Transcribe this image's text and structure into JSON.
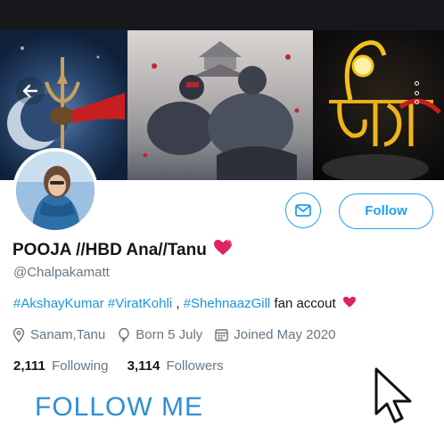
{
  "profile": {
    "display_name": "POOJA //HBD Ana//Tanu",
    "handle": "@Chalpakamatt",
    "bio": {
      "tags": [
        "#AkshayKumar",
        "#ViratKohli",
        "#ShehnaazGill"
      ],
      "separator": ",",
      "text": "fan accout"
    },
    "location": "Sanam,Tanu",
    "born": "Born 5 July",
    "joined": "Joined May 2020",
    "following_count": "2,111",
    "following_label": "Following",
    "followers_count": "3,114",
    "followers_label": "Followers"
  },
  "actions": {
    "follow_label": "Follow",
    "message_icon": "envelope-icon",
    "back_icon": "arrow-left-icon",
    "more_icon": "vertical-dots-icon"
  },
  "overlay": {
    "caption": "FOLLOW ME",
    "cursor_icon": "mouse-pointer-icon"
  },
  "colors": {
    "accent": "#1da1f2",
    "link": "#1b95e0",
    "secondary_text": "#657786",
    "caption": "#2e8fd4",
    "heart": "#e0245e"
  }
}
